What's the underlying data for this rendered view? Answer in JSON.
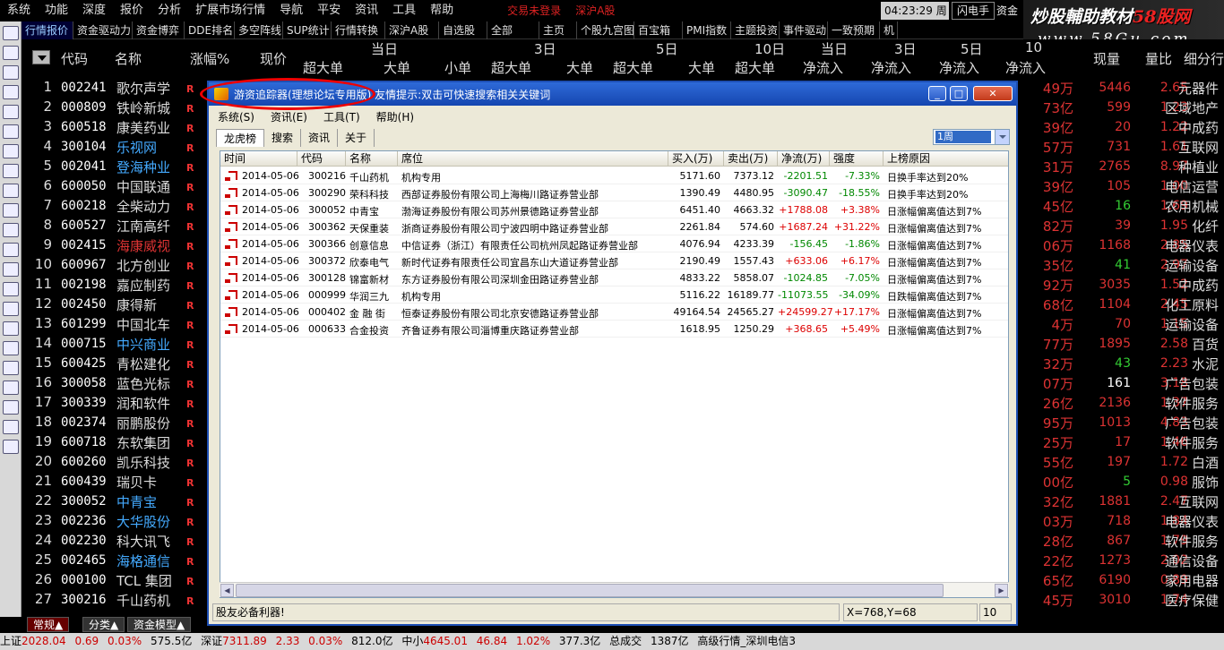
{
  "menu": [
    "系统",
    "功能",
    "深度",
    "报价",
    "分析",
    "扩展市场行情",
    "导航",
    "平安",
    "资讯",
    "工具",
    "帮助"
  ],
  "trade_labels": [
    "交易未登录",
    "深沪A股"
  ],
  "clock": "04:23:29 周三",
  "flash_label": "闪电手",
  "fund_label": "资金",
  "watermark": {
    "line1_a": "炒股輔助教材",
    "line1_b": "58股网",
    "line2": "www.58Gu.com"
  },
  "toolbar_tabs": [
    "行情报价",
    "资金驱动力",
    "资金博弈",
    "DDE排名",
    "多空阵线",
    "SUP统计",
    "行情转换",
    "深沪A股",
    "自选股",
    "全部",
    "主页",
    "个股九宫图",
    "百宝箱",
    "PMI指数",
    "主题投资",
    "事件驱动",
    "一致预期",
    "机"
  ],
  "table_header": {
    "code": "代码",
    "name": "名称",
    "change": "涨幅%",
    "price": "现价",
    "groups": [
      "当日",
      "3日",
      "5日",
      "10日",
      "当日",
      "3日",
      "5日",
      "10"
    ],
    "subs": [
      "超大单",
      "大单",
      "小单",
      "超大单",
      "大单",
      "超大单",
      "大单",
      "超大单",
      "净流入",
      "净流入",
      "净流入",
      "净流入"
    ],
    "vol": "现量",
    "ratio": "量比",
    "industry": "细分行业"
  },
  "stocks": [
    {
      "i": "1",
      "code": "002241",
      "name": "歌尔声学",
      "amt": "49万",
      "vol": "5446",
      "ratio": "2.65",
      "ind": "元器件",
      "vc": "#d33"
    },
    {
      "i": "2",
      "code": "000809",
      "name": "铁岭新城",
      "amt": "73亿",
      "vol": "599",
      "ratio": "1.23",
      "ind": "区域地产",
      "vc": "#d33"
    },
    {
      "i": "3",
      "code": "600518",
      "name": "康美药业",
      "amt": "39亿",
      "vol": "20",
      "ratio": "1.22",
      "ind": "中成药",
      "vc": "#d33"
    },
    {
      "i": "4",
      "code": "300104",
      "name": "乐视网",
      "amt": "57万",
      "vol": "731",
      "ratio": "1.61",
      "ind": "互联网",
      "vc": "#d33",
      "nc": "#4af"
    },
    {
      "i": "5",
      "code": "002041",
      "name": "登海种业",
      "amt": "31万",
      "vol": "2765",
      "ratio": "8.97",
      "ind": "种植业",
      "vc": "#d33",
      "nc": "#4af"
    },
    {
      "i": "6",
      "code": "600050",
      "name": "中国联通",
      "amt": "39亿",
      "vol": "105",
      "ratio": "1.00",
      "ind": "电信运营",
      "vc": "#d33"
    },
    {
      "i": "7",
      "code": "600218",
      "name": "全柴动力",
      "amt": "45亿",
      "vol": "16",
      "ratio": "1.69",
      "ind": "农用机械",
      "vc": "#3c3"
    },
    {
      "i": "8",
      "code": "600527",
      "name": "江南高纤",
      "amt": "82万",
      "vol": "39",
      "ratio": "1.95",
      "ind": "化纤",
      "vc": "#d33"
    },
    {
      "i": "9",
      "code": "002415",
      "name": "海康威视",
      "amt": "06万",
      "vol": "1168",
      "ratio": "2.85",
      "ind": "电器仪表",
      "vc": "#d33",
      "nc": "#d33"
    },
    {
      "i": "10",
      "code": "600967",
      "name": "北方创业",
      "amt": "35亿",
      "vol": "41",
      "ratio": "2.97",
      "ind": "运输设备",
      "vc": "#3c3"
    },
    {
      "i": "11",
      "code": "002198",
      "name": "嘉应制药",
      "amt": "92万",
      "vol": "3035",
      "ratio": "1.52",
      "ind": "中成药",
      "vc": "#d33"
    },
    {
      "i": "12",
      "code": "002450",
      "name": "康得新",
      "amt": "68亿",
      "vol": "1104",
      "ratio": "2.45",
      "ind": "化工原料",
      "vc": "#d33"
    },
    {
      "i": "13",
      "code": "601299",
      "name": "中国北车",
      "amt": "4万",
      "vol": "70",
      "ratio": "1.15",
      "ind": "运输设备",
      "vc": "#d33"
    },
    {
      "i": "14",
      "code": "000715",
      "name": "中兴商业",
      "amt": "77万",
      "vol": "1895",
      "ratio": "2.58",
      "ind": "百货",
      "vc": "#d33",
      "nc": "#4af"
    },
    {
      "i": "15",
      "code": "600425",
      "name": "青松建化",
      "amt": "32万",
      "vol": "43",
      "ratio": "2.23",
      "ind": "水泥",
      "vc": "#3c3"
    },
    {
      "i": "16",
      "code": "300058",
      "name": "蓝色光标",
      "amt": "07万",
      "vol": "161",
      "ratio": "3.18",
      "ind": "广告包装",
      "vc": "#fff"
    },
    {
      "i": "17",
      "code": "300339",
      "name": "润和软件",
      "amt": "26亿",
      "vol": "2136",
      "ratio": "1.37",
      "ind": "软件服务",
      "vc": "#d33"
    },
    {
      "i": "18",
      "code": "002374",
      "name": "丽鹏股份",
      "amt": "95万",
      "vol": "1013",
      "ratio": "4.83",
      "ind": "广告包装",
      "vc": "#d33"
    },
    {
      "i": "19",
      "code": "600718",
      "name": "东软集团",
      "amt": "25万",
      "vol": "17",
      "ratio": "1.46",
      "ind": "软件服务",
      "vc": "#d33"
    },
    {
      "i": "20",
      "code": "600260",
      "name": "凯乐科技",
      "amt": "55亿",
      "vol": "197",
      "ratio": "1.72",
      "ind": "白酒",
      "vc": "#d33"
    },
    {
      "i": "21",
      "code": "600439",
      "name": "瑞贝卡",
      "amt": "00亿",
      "vol": "5",
      "ratio": "0.98",
      "ind": "服饰",
      "vc": "#3c3"
    },
    {
      "i": "22",
      "code": "300052",
      "name": "中青宝",
      "amt": "32亿",
      "vol": "1881",
      "ratio": "2.47",
      "ind": "互联网",
      "vc": "#d33",
      "nc": "#4af"
    },
    {
      "i": "23",
      "code": "002236",
      "name": "大华股份",
      "amt": "03万",
      "vol": "718",
      "ratio": "1.84",
      "ind": "电器仪表",
      "vc": "#d33",
      "nc": "#4af"
    },
    {
      "i": "24",
      "code": "002230",
      "name": "科大讯飞",
      "amt": "28亿",
      "vol": "867",
      "ratio": "1.79",
      "ind": "软件服务",
      "vc": "#d33"
    },
    {
      "i": "25",
      "code": "002465",
      "name": "海格通信",
      "amt": "22亿",
      "vol": "1273",
      "ratio": "2.02",
      "ind": "通信设备",
      "vc": "#d33",
      "nc": "#4af"
    },
    {
      "i": "26",
      "code": "000100",
      "name": "TCL 集团",
      "amt": "65亿",
      "vol": "6190",
      "ratio": "0.89",
      "ind": "家用电器",
      "vc": "#d33"
    },
    {
      "i": "27",
      "code": "300216",
      "name": "千山药机",
      "amt": "45万",
      "vol": "3010",
      "ratio": "1.74",
      "ind": "医疗保健",
      "vc": "#d33"
    }
  ],
  "bottom_tabs": [
    "常规▲",
    "分类▲",
    "资金模型▲"
  ],
  "status": {
    "sh": "上证",
    "sh_val": "2028.04",
    "sh_chg": "0.69",
    "sh_pct": "0.03%",
    "sh_amt": "575.5亿",
    "sz": "深证",
    "sz_val": "7311.89",
    "sz_chg": "2.33",
    "sz_pct": "0.03%",
    "sz_amt": "812.0亿",
    "zx": "中小",
    "zx_val": "4645.01",
    "zx_chg": "46.84",
    "zx_pct": "1.02%",
    "zx_amt": "377.3亿",
    "deal": "总成交",
    "deal_val": "1387亿",
    "quote": "高级行情_深圳电信3"
  },
  "popup": {
    "title": "游资追踪器(理想论坛专用版)  友情提示:双击可快速搜索相关关键词",
    "menu": [
      "系统(S)",
      "资讯(E)",
      "工具(T)",
      "帮助(H)"
    ],
    "tabs": [
      "龙虎榜",
      "搜索",
      "资讯",
      "关于"
    ],
    "period": "1周",
    "columns": [
      "时间",
      "代码",
      "名称",
      "席位",
      "买入(万)",
      "卖出(万)",
      "净流(万)",
      "强度",
      "上榜原因"
    ],
    "rows": [
      {
        "date": "2014-05-06",
        "code": "300216",
        "name": "千山药机",
        "seat": "机构专用",
        "buy": "5171.60",
        "sell": "7373.12",
        "net": "-2201.51",
        "str": "-7.33%",
        "reason": "日换手率达到20%"
      },
      {
        "date": "2014-05-06",
        "code": "300290",
        "name": "荣科科技",
        "seat": "西部证券股份有限公司上海梅川路证券营业部",
        "buy": "1390.49",
        "sell": "4480.95",
        "net": "-3090.47",
        "str": "-18.55%",
        "reason": "日换手率达到20%"
      },
      {
        "date": "2014-05-06",
        "code": "300052",
        "name": "中青宝",
        "seat": "渤海证券股份有限公司苏州景德路证券营业部",
        "buy": "6451.40",
        "sell": "4663.32",
        "net": "+1788.08",
        "str": "+3.38%",
        "reason": "日涨幅偏离值达到7%"
      },
      {
        "date": "2014-05-06",
        "code": "300362",
        "name": "天保重装",
        "seat": "浙商证券股份有限公司宁波四明中路证券营业部",
        "buy": "2261.84",
        "sell": "574.60",
        "net": "+1687.24",
        "str": "+31.22%",
        "reason": "日涨幅偏离值达到7%"
      },
      {
        "date": "2014-05-06",
        "code": "300366",
        "name": "创意信息",
        "seat": "中信证券（浙江）有限责任公司杭州凤起路证券营业部",
        "buy": "4076.94",
        "sell": "4233.39",
        "net": "-156.45",
        "str": "-1.86%",
        "reason": "日涨幅偏离值达到7%"
      },
      {
        "date": "2014-05-06",
        "code": "300372",
        "name": "欣泰电气",
        "seat": "新时代证券有限责任公司宜昌东山大道证券营业部",
        "buy": "2190.49",
        "sell": "1557.43",
        "net": "+633.06",
        "str": "+6.17%",
        "reason": "日涨幅偏离值达到7%"
      },
      {
        "date": "2014-05-06",
        "code": "300128",
        "name": "锦富新材",
        "seat": "东方证券股份有限公司深圳金田路证券营业部",
        "buy": "4833.22",
        "sell": "5858.07",
        "net": "-1024.85",
        "str": "-7.05%",
        "reason": "日涨幅偏离值达到7%"
      },
      {
        "date": "2014-05-06",
        "code": "000999",
        "name": "华润三九",
        "seat": "机构专用",
        "buy": "5116.22",
        "sell": "16189.77",
        "net": "-11073.55",
        "str": "-34.09%",
        "reason": "日跌幅偏离值达到7%"
      },
      {
        "date": "2014-05-06",
        "code": "000402",
        "name": "金 融 街",
        "seat": "恒泰证券股份有限公司北京安德路证券营业部",
        "buy": "49164.54",
        "sell": "24565.27",
        "net": "+24599.27",
        "str": "+17.17%",
        "reason": "日涨幅偏离值达到7%"
      },
      {
        "date": "2014-05-06",
        "code": "000633",
        "name": "合金投资",
        "seat": "齐鲁证券有限公司淄博重庆路证券营业部",
        "buy": "1618.95",
        "sell": "1250.29",
        "net": "+368.65",
        "str": "+5.49%",
        "reason": "日涨幅偏离值达到7%"
      }
    ],
    "status_left": "股友必备利器!",
    "status_coords": "X=768,Y=68",
    "status_count": "10"
  }
}
